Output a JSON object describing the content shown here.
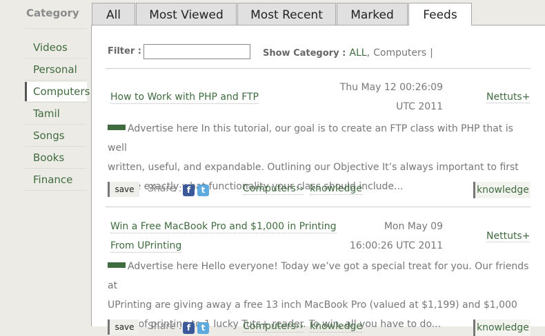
{
  "sidebar": {
    "title": "Category",
    "items": [
      {
        "label": "Videos"
      },
      {
        "label": "Personal"
      },
      {
        "label": "Computers"
      },
      {
        "label": "Tamil"
      },
      {
        "label": "Songs"
      },
      {
        "label": "Books"
      },
      {
        "label": "Finance"
      }
    ],
    "active": "Computers"
  },
  "tabs": [
    {
      "label": "All"
    },
    {
      "label": "Most Viewed"
    },
    {
      "label": "Most Recent"
    },
    {
      "label": "Marked"
    },
    {
      "label": "Feeds"
    }
  ],
  "active_tab": "Feeds",
  "filter": {
    "label": "Filter :",
    "value": "",
    "placeholder": ""
  },
  "show_category": {
    "label": "Show Category :",
    "all": "ALL",
    "sep": ",",
    "computers": "Computers",
    "pipe": "|"
  },
  "items": [
    {
      "title": "How to Work with PHP and FTP",
      "date_line1": "Thu May 12 00:26:09",
      "date_line2": "UTC 2011",
      "source": "Nettuts+",
      "body_line1": "Advertise here In this tutorial, our goal is to create an FTP class with PHP that is well",
      "body_line2": "written, useful, and expandable. Outlining our Objective It’s always important to first",
      "body_line3": "outline exactly what functionality your class should include...",
      "save": "save",
      "share": "Share :",
      "category": "Computers››",
      "tag": "knowledge",
      "badge": "knowledge"
    },
    {
      "title_line1": "Win a Free MacBook Pro and $1,000 in Printing",
      "title_line2": "From UPrinting",
      "date_line1": "Mon May 09",
      "date_line2": "16:00:26 UTC 2011",
      "source": "Nettuts+",
      "body_line1": "Advertise here Hello everyone! Today we’ve got a special treat for you. Our friends at",
      "body_line2": "UPrinting are giving away a free 13 inch MacBook Pro (valued at $1,199) and $1,000",
      "body_line3": "worth of printing to 1 lucky Tuts+ reader. To win, all you have to do...",
      "save": "save",
      "share": "Share :",
      "category": "Computers››",
      "tag": "knowledge",
      "badge": "knowledge"
    }
  ],
  "icons": {
    "facebook": "f",
    "twitter": "t"
  },
  "colors": {
    "accent_green": "#3f6b3f",
    "background": "#ecebe6",
    "panel": "#ffffff"
  }
}
